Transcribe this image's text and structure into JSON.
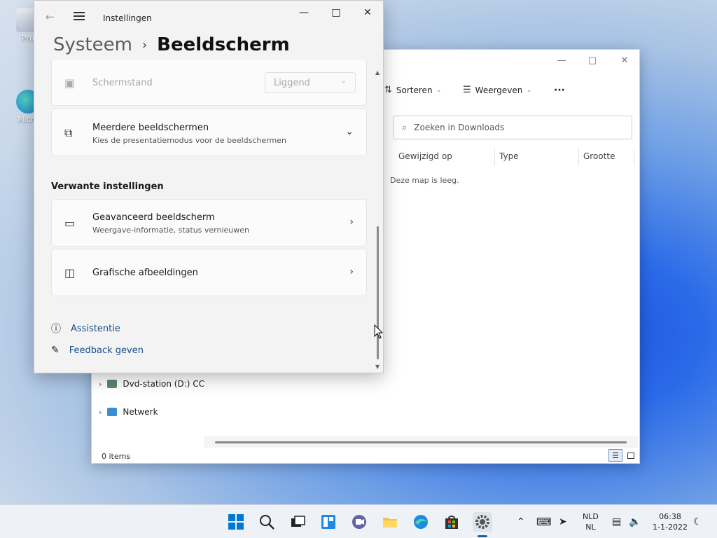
{
  "desktop": {
    "icons": [
      {
        "label": "Pru"
      },
      {
        "label": "Micro"
      }
    ]
  },
  "explorer": {
    "toolbar": {
      "sort_label": "Sorteren",
      "view_label": "Weergeven",
      "more_label": "···"
    },
    "search": {
      "placeholder": "Zoeken in Downloads"
    },
    "columns": [
      "Gewijzigd op",
      "Type",
      "Grootte"
    ],
    "empty_message": "Deze map is leeg.",
    "tree": [
      {
        "label": "Dvd-station (D:) CC"
      },
      {
        "label": "Netwerk"
      }
    ],
    "status": {
      "items": "0 items"
    }
  },
  "settings": {
    "title": "Instellingen",
    "breadcrumb": {
      "parent": "Systeem",
      "separator": "›",
      "current": "Beeldscherm"
    },
    "orientation": {
      "label": "Schermstand",
      "value": "Liggend"
    },
    "multi_display": {
      "title": "Meerdere beeldschermen",
      "subtitle": "Kies de presentatiemodus voor de beeldschermen"
    },
    "related_title": "Verwante instellingen",
    "advanced": {
      "title": "Geavanceerd beeldscherm",
      "subtitle": "Weergave-informatie, status vernieuwen"
    },
    "graphics": {
      "title": "Grafische afbeeldingen"
    },
    "links": {
      "help": "Assistentie",
      "feedback": "Feedback geven"
    }
  },
  "taskbar": {
    "language": {
      "line1": "NLD",
      "line2": "NL"
    },
    "clock": {
      "time": "06:38",
      "date": "1-1-2022"
    }
  },
  "colors": {
    "accent": "#0067c0",
    "link": "#1a4d8c"
  }
}
